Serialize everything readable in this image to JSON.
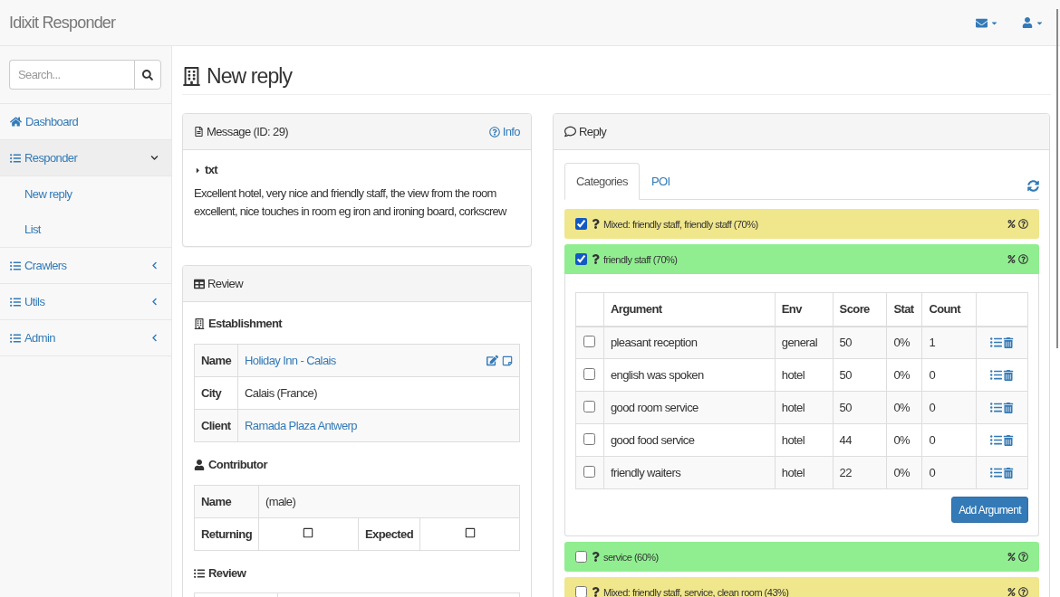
{
  "navbar": {
    "brand": "Idixit Responder"
  },
  "sidebar": {
    "search": {
      "placeholder": "Search..."
    },
    "items": [
      {
        "label": "Dashboard",
        "kind": "link"
      },
      {
        "label": "Responder",
        "kind": "group",
        "expanded": true,
        "children": [
          {
            "label": "New reply"
          },
          {
            "label": "List"
          }
        ]
      },
      {
        "label": "Crawlers",
        "kind": "group",
        "expanded": false
      },
      {
        "label": "Utils",
        "kind": "group",
        "expanded": false
      },
      {
        "label": "Admin",
        "kind": "group",
        "expanded": false
      }
    ]
  },
  "page": {
    "title": "New reply"
  },
  "message_panel": {
    "title": "Message (ID: 29)",
    "info_link": "Info",
    "section": "txt",
    "text": "Excellent hotel, very nice and friendly staff, the view from the room excellent, nice touches in room eg iron and ironing board, corkscrew"
  },
  "review_panel": {
    "title": "Review",
    "establishment": {
      "heading": "Establishment",
      "rows": [
        {
          "label": "Name",
          "value": "Holiday Inn - Calais",
          "kind": "link",
          "editable": true
        },
        {
          "label": "City",
          "value": "Calais (France)",
          "kind": "text",
          "editable": false
        },
        {
          "label": "Client",
          "value": "Ramada Plaza Antwerp",
          "kind": "link",
          "editable": false
        }
      ]
    },
    "contributor": {
      "heading": "Contributor",
      "name_label": "Name",
      "name": "(male)",
      "flags": [
        {
          "label": "Returning",
          "checked": false
        },
        {
          "label": "Expected",
          "checked": false
        }
      ]
    },
    "review_heading": "Review"
  },
  "reply_panel": {
    "title": "Reply",
    "tabs": [
      {
        "label": "Categories",
        "selected": true
      },
      {
        "label": "POI",
        "selected": false
      }
    ],
    "categories": [
      {
        "label": "Mixed: friendly staff, friendly staff (70%)",
        "checked": true,
        "color": "#f0e68c",
        "expanded": false
      },
      {
        "label": "friendly staff (70%)",
        "checked": true,
        "color": "#90ee90",
        "expanded": true,
        "table": {
          "columns": [
            "Argument",
            "Env",
            "Score",
            "Stat",
            "Count"
          ],
          "rows": [
            {
              "checked": false,
              "cells": [
                "pleasant reception",
                "general",
                "50",
                "0%",
                "1"
              ]
            },
            {
              "checked": false,
              "cells": [
                "english was spoken",
                "hotel",
                "50",
                "0%",
                "0"
              ]
            },
            {
              "checked": false,
              "cells": [
                "good room service",
                "hotel",
                "50",
                "0%",
                "0"
              ]
            },
            {
              "checked": false,
              "cells": [
                "good food service",
                "hotel",
                "44",
                "0%",
                "0"
              ]
            },
            {
              "checked": false,
              "cells": [
                "friendly waiters",
                "hotel",
                "22",
                "0%",
                "0"
              ]
            }
          ]
        },
        "add_button": "Add Argument"
      },
      {
        "label": "service (60%)",
        "checked": false,
        "color": "#90ee90",
        "expanded": false
      },
      {
        "label": "Mixed: friendly staff, service, clean room (43%)",
        "checked": false,
        "color": "#f0e68c",
        "expanded": false
      }
    ]
  }
}
